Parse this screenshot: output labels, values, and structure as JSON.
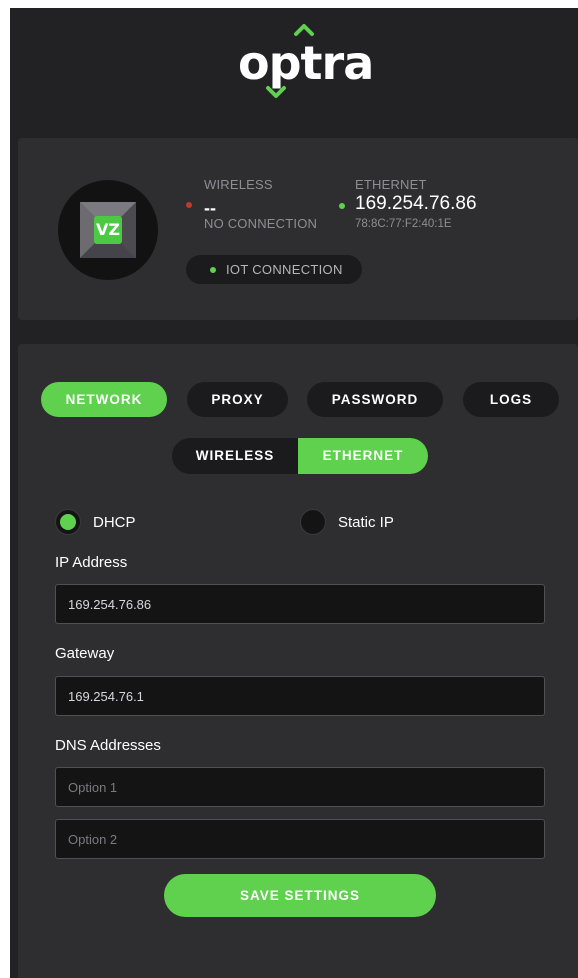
{
  "brand": {
    "logo_text": "optra"
  },
  "status": {
    "avatar_badge": "VZ",
    "wireless": {
      "label": "WIRELESS",
      "value": "--",
      "sub": "NO CONNECTION",
      "dot_color": "#c03a2b"
    },
    "ethernet": {
      "label": "ETHERNET",
      "ip": "169.254.76.86",
      "mac": "78:8C:77:F2:40:1E",
      "dot_color": "#5fd14e"
    },
    "iot": {
      "label": "IOT CONNECTION"
    }
  },
  "tabs": [
    "NETWORK",
    "PROXY",
    "PASSWORD",
    "LOGS"
  ],
  "segmented": {
    "options": [
      "WIRELESS",
      "ETHERNET"
    ],
    "selected": "ETHERNET"
  },
  "addressing": {
    "options": [
      "DHCP",
      "Static IP"
    ],
    "selected": "DHCP"
  },
  "form": {
    "ip_label": "IP Address",
    "ip_value": "169.254.76.86",
    "gateway_label": "Gateway",
    "gateway_value": "169.254.76.1",
    "dns_label": "DNS Addresses",
    "dns1_placeholder": "Option 1",
    "dns2_placeholder": "Option 2"
  },
  "save_label": "SAVE SETTINGS",
  "colors": {
    "accent": "#5fd14e",
    "background": "#222224",
    "card": "#2e2e31"
  }
}
